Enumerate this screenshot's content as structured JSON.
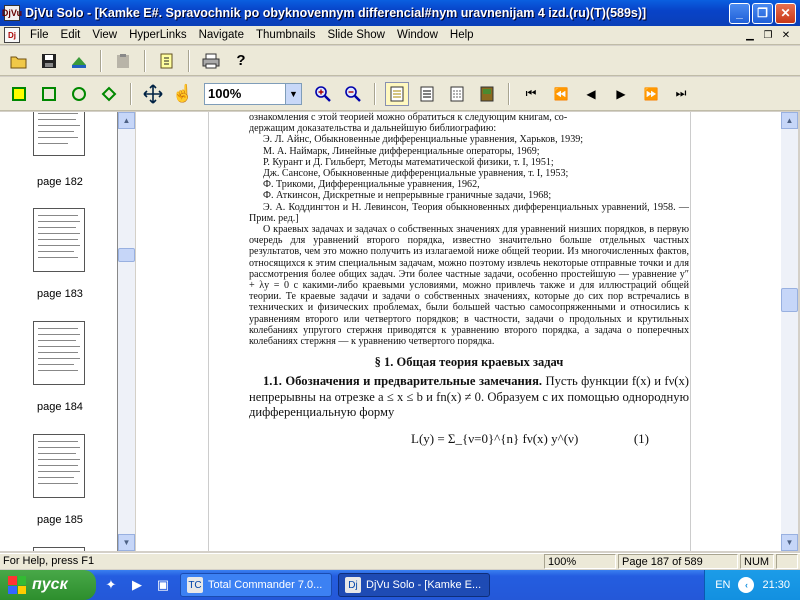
{
  "window": {
    "title": "DjVu Solo - [Kamke E#. Spravochnik po obyknovennym differencial#nym uravnenijam 4 izd.(ru)(T)(589s)]",
    "app_icon": "DjVu"
  },
  "menu": {
    "items": [
      "File",
      "Edit",
      "View",
      "HyperLinks",
      "Navigate",
      "Thumbnails",
      "Slide Show",
      "Window",
      "Help"
    ]
  },
  "toolbar": {
    "zoom_value": "100%"
  },
  "thumbnails": [
    {
      "label": "page 182"
    },
    {
      "label": "page 183"
    },
    {
      "label": "page 184"
    },
    {
      "label": "page 185"
    }
  ],
  "document": {
    "lines_top": [
      "ознакомления с этой теорией можно обратиться к следующим книгам, со-",
      "держащим доказательства и дальнейшую библиографию:"
    ],
    "refs": [
      "Э. Л. Айнс, Обыкновенные дифференциальные уравнения, Харьков, 1939;",
      "М. А. Наймарк, Линейные дифференциальные операторы, 1969;",
      "Р. Курант и Д. Гильберт, Методы математической физики, т. I, 1951;",
      "Дж. Сансоне, Обыкновенные дифференциальные уравнения, т. I, 1953;",
      "Ф. Трикоми, Дифференциальные уравнения, 1962,",
      "Ф. Аткинсон, Дискретные и непрерывные граничные задачи, 1968;",
      "Э. А. Коддингтон и Н. Левинсон, Теория обыкновенных дифференциальных уравнений, 1958. — Прим. ред.]"
    ],
    "paragraph": "О краевых задачах и задачах о собственных значениях для уравнений низших порядков, в первую очередь для уравнений второго порядка, известно значительно больше отдельных частных результатов, чем это можно получить из излагаемой ниже общей теории. Из многочисленных фактов, относящихся к этим специальным задачам, можно поэтому извлечь некоторые отправные точки и для рассмотрения более общих задач. Эти более частные задачи, особенно простейшую — уравнение y″ + λy = 0 с какими-либо краевыми условиями, можно привлечь также и для иллюстраций общей теории. Те краевые задачи и задачи о собственных значениях, которые до сих пор встречались в технических и физических проблемах, были большей частью самосопряженными и относились к уравнениям второго или четвертого порядков; в частности, задачи о продольных и крутильных колебаниях упругого стержня приводятся к уравнению второго порядка, а задача о поперечных колебаниях стержня — к уравнению четвертого порядка.",
    "section_heading": "§ 1. Общая теория краевых задач",
    "subsection_bold": "1.1. Обозначения и предварительные замечания.",
    "subsection_text": " Пусть функции f(x) и fν(x) непрерывны на отрезке a ≤ x ≤ b и fn(x) ≠ 0. Образуем с их помощью однородную дифференциальную форму",
    "formula": "L(y) = Σ_{ν=0}^{n} fν(x) y^(ν)",
    "formula_number": "(1)"
  },
  "status": {
    "help": "For Help, press F1",
    "zoom": "100%",
    "page": "Page 187 of 589",
    "num": "NUM"
  },
  "taskbar": {
    "start": "пуск",
    "tasks": [
      {
        "label": "Total Commander 7.0...",
        "active": false
      },
      {
        "label": "DjVu Solo - [Kamke E...",
        "active": true
      }
    ],
    "lang": "EN",
    "clock": "21:30"
  }
}
